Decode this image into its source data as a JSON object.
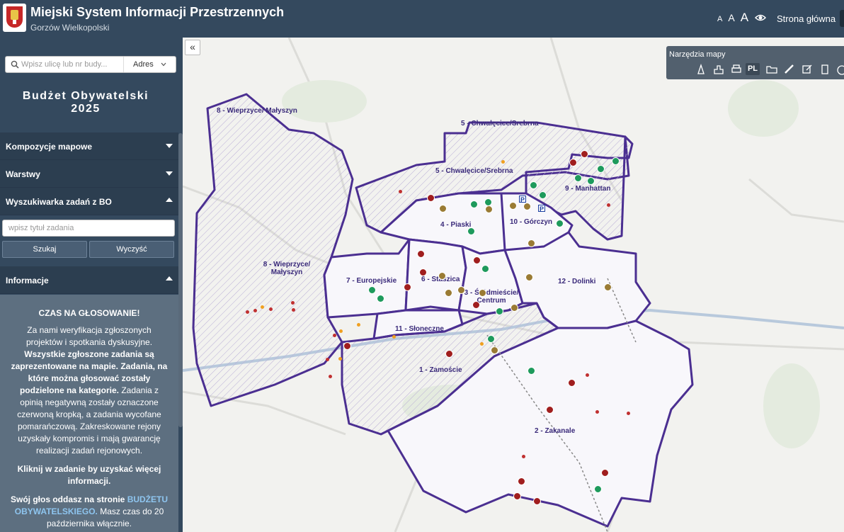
{
  "header": {
    "title": "Miejski System Informacji Przestrzennych",
    "subtitle": "Gorzów Wielkopolski",
    "font_sizes": [
      "A",
      "A",
      "A"
    ],
    "home_link": "Strona główna"
  },
  "sidebar": {
    "search_placeholder": "Wpisz ulicę lub nr budy...",
    "search_mode": "Adres",
    "budget_title_line1": "Budżet Obywatelski",
    "budget_title_line2": "2025",
    "sections": {
      "map_compositions": "Kompozycje mapowe",
      "layers": "Warstwy",
      "task_search": "Wyszukiwarka zadań z BO",
      "information": "Informacje"
    },
    "task_search_placeholder": "wpisz tytuł zadania",
    "search_button": "Szukaj",
    "clear_button": "Wyczyść",
    "info": {
      "heading": "CZAS NA GŁOSOWANIE!",
      "p1_a": "Za nami weryfikacja zgłoszonych projektów i spotkania dyskusyjne. ",
      "p1_b": "Wszystkie zgłoszone zadania są zaprezentowane na mapie. Zadania, na które można głosować zostały podzielone na kategorie.",
      "p1_c": " Zadania z opinią negatywną zostały oznaczone czerwoną kropką, a zadania wycofane pomarańczową. Zakreskowane rejony uzyskały kompromis i mają gwarancję realizacji zadań rejonowych.",
      "p2": "Kliknij w zadanie by uzyskać więcej informacji.",
      "p3_a": "Swój głos oddasz na stronie ",
      "p3_link": "BUDŻETU OBYWATELSKIEGO.",
      "p3_b": " Masz czas do 20 października włącznie."
    }
  },
  "map": {
    "tools_title": "Narzędzia mapy",
    "lang_button": "PL",
    "tools": [
      "cone-icon",
      "building-icon",
      "print-icon",
      "folder-icon",
      "ruler-icon",
      "edit-icon",
      "document-icon",
      "gauge-icon"
    ],
    "districts": {
      "d8_top": "8 - Wieprzyce/ Małyszyn",
      "d5_top": "5 - Chwalęcice/Srebrna",
      "d5": "5 - Chwalęcice/Srebrna",
      "d9": "9 - Manhattan",
      "d4": "4 - Piaski",
      "d10": "10 - Górczyn",
      "d8": "8 - Wieprzyce/ Małyszyn",
      "d7": "7 - Europejskie",
      "d6": "6 - Staszica",
      "d3": "3 - Śródmieście/ Centrum",
      "d12": "12 - Dolinki",
      "d11": "11 - Słoneczne",
      "d1": "1 - Zamoście",
      "d2": "2 - Zakanale"
    },
    "parking_symbol": "P",
    "colors": {
      "boundary": "#4b2f91",
      "negative": "#c03030",
      "withdrawn": "#f0a020",
      "sidebar": "#34495e"
    }
  }
}
